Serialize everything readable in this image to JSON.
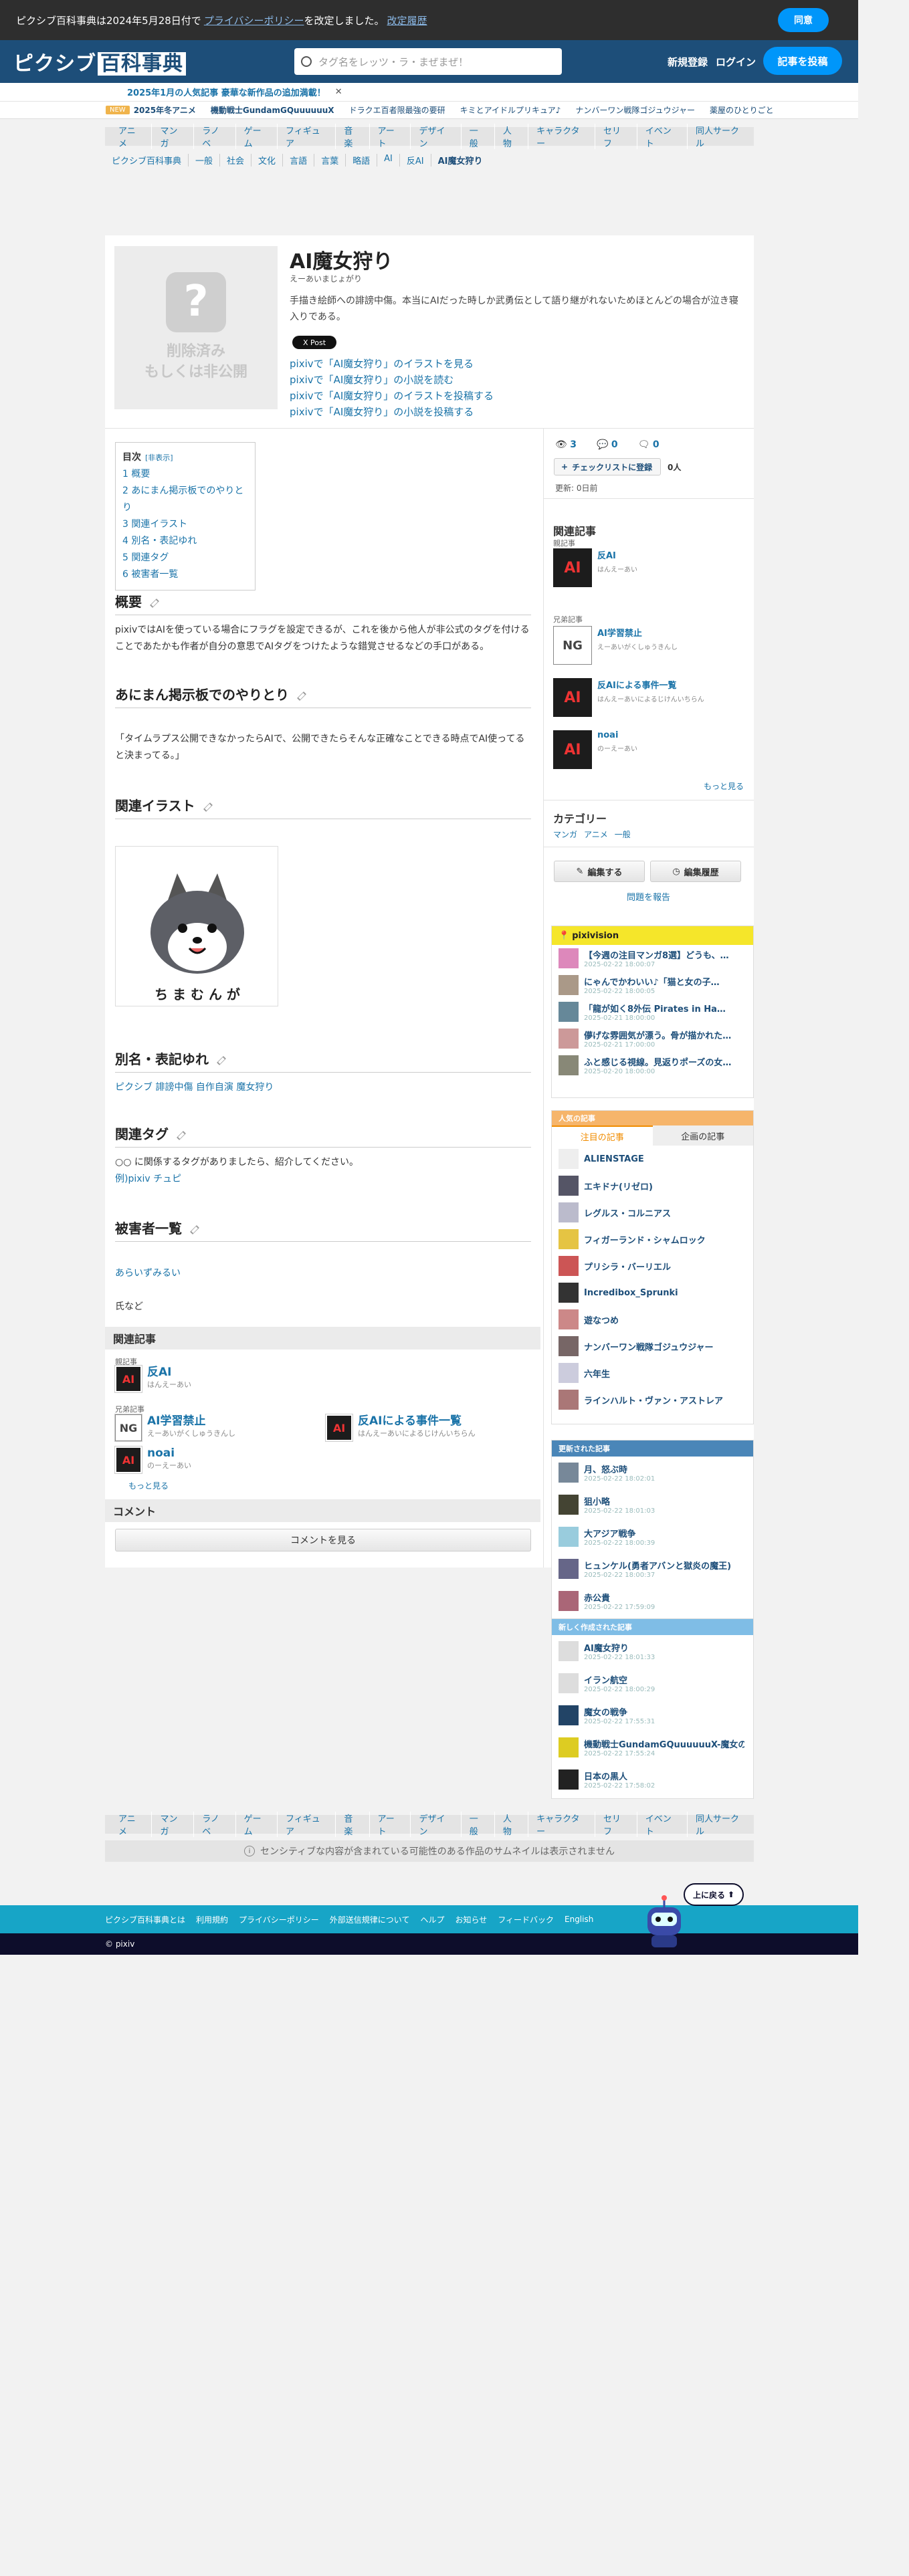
{
  "cookie": {
    "text": "ピクシブ百科事典は2024年5月28日付で",
    "link": "プライバシーポリシー",
    "text2": "を改定しました。",
    "history": "改定履歴",
    "agree": "同意"
  },
  "header": {
    "logo": "ピクシブ",
    "logo_box": "百科事典",
    "search_placeholder": "タグ名をレッツ・ラ・まぜまぜ！",
    "signup": "新規登録",
    "login": "ログイン",
    "post": "記事を投稿"
  },
  "news1": {
    "text": "2025年1月の人気記事 豪華な新作品の追加満載！",
    "close": "✕"
  },
  "news2": {
    "tag": "NEW",
    "title": "2025年冬アニメ",
    "items": [
      "機動戦士GundamGQuuuuuuX",
      "ドラクエ百者限最強の要研",
      "キミとアイドルプリキュア♪",
      "ナンバーワン戦隊ゴジュウジャー",
      "薬屋のひとりごと"
    ]
  },
  "catnav": [
    "アニメ",
    "マンガ",
    "ラノベ",
    "ゲーム",
    "フィギュア",
    "音楽",
    "アート",
    "デザイン",
    "一般",
    "人物",
    "キャラクター",
    "セリフ",
    "イベント",
    "同人サークル"
  ],
  "breadcrumbs": [
    "ピクシブ百科事典",
    "一般",
    "社会",
    "文化",
    "言語",
    "言葉",
    "略語",
    "AI",
    "反AI",
    "AI魔女狩り"
  ],
  "article": {
    "thumb_line1": "削除済み",
    "thumb_line2": "もしくは非公開",
    "title": "AI魔女狩り",
    "reading": "えーあいまじょがり",
    "summary": "手描き絵師への誹謗中傷。本当にAIだった時しか武勇伝として語り継がれないためほとんどの場合が泣き寝入りである。",
    "xpost": "X Post",
    "links": [
      "pixivで「AI魔女狩り」のイラストを見る",
      "pixivで「AI魔女狩り」の小説を読む",
      "pixivで「AI魔女狩り」のイラストを投稿する",
      "pixivで「AI魔女狩り」の小説を投稿する"
    ]
  },
  "toc": {
    "title": "目次",
    "toggle": "[非表示]",
    "items": [
      "1 概要",
      "2 あにまん掲示板でのやりとり",
      "3 関連イラスト",
      "4 別名・表記ゆれ",
      "5 関連タグ",
      "6 被害者一覧"
    ]
  },
  "sections": {
    "overview_h": "概要",
    "overview_p": "pixivではAIを使っている場合にフラグを設定できるが、これを後から他人が非公式のタグを付けることであたかも作者が自分の意思でAIタグをつけたような錯覚させるなどの手口がある。",
    "animan_h": "あにまん掲示板でのやりとり",
    "animan_p": "「タイムラプス公開できなかったらAIで、公開できたらそんな正確なことできる時点でAI使ってると決まってる。」",
    "illust_h": "関連イラスト",
    "alias_h": "別名・表記ゆれ",
    "alias_p": "ピクシブ 誹謗中傷 自作自演 魔女狩り",
    "tags_h": "関連タグ",
    "tags_p1": "○○ に関係するタグがありましたら、紹介してください。",
    "tags_p2": "例)pixiv チュピ",
    "victims_h": "被害者一覧",
    "victims_p1": "あらいずみるい",
    "victims_p2": "氏など"
  },
  "related": {
    "bar": "関連記事",
    "parent_label": "親記事",
    "parent": {
      "icon": "AI",
      "name": "反AI",
      "reading": "はんえーあい"
    },
    "sibling_label": "兄弟記事",
    "siblings": [
      {
        "icon": "NG",
        "name": "AI学習禁止",
        "reading": "えーあいがくしゅうきんし"
      },
      {
        "icon": "AI",
        "name": "反AIによる事件一覧",
        "reading": "はんえーあいによるじけんいちらん"
      },
      {
        "icon": "AI",
        "name": "noai",
        "reading": "のーえーあい"
      }
    ],
    "more": "もっと見る"
  },
  "comments": {
    "bar": "コメント",
    "button": "コメントを見る"
  },
  "side": {
    "views": "3",
    "comments": "0",
    "tags": "0",
    "checklist": "チェックリストに登録",
    "people": "0人",
    "updated": "更新: 0日前",
    "related_title": "関連記事",
    "parent_label": "親記事",
    "sibling_label": "兄弟記事",
    "more": "もっと見る",
    "category_title": "カテゴリー",
    "categories": [
      "マンガ",
      "アニメ",
      "一般"
    ],
    "edit": "編集する",
    "history": "編集履歴",
    "report": "問題を報告"
  },
  "pixivision": {
    "head": "pixivision",
    "items": [
      {
        "text": "【今週の注目マンガ8選】どうも、…",
        "date": "2025-02-22 18:00:07"
      },
      {
        "text": "にゃんでかわいい♪「猫と女の子…",
        "date": "2025-02-22 18:00:05"
      },
      {
        "text": "「龍が如く8外伝 Pirates in Ha…",
        "date": "2025-02-21 18:00:00"
      },
      {
        "text": "儚げな雰囲気が漂う。骨が描かれた…",
        "date": "2025-02-21 17:00:00"
      },
      {
        "text": "ふと感じる視線。見返りポーズの女…",
        "date": "2025-02-20 18:00:00"
      }
    ]
  },
  "popular": {
    "head": "人気の記事",
    "tab1": "注目の記事",
    "tab2": "企画の記事",
    "items": [
      "ALIENSTAGE",
      "エキドナ(リゼロ)",
      "レグルス・コルニアス",
      "フィガーランド・シャムロック",
      "プリシラ・バーリエル",
      "Incredibox_Sprunki",
      "遊なつめ",
      "ナンバーワン戦隊ゴジュウジャー",
      "六年生",
      "ラインハルト・ヴァン・アストレア"
    ]
  },
  "updated": {
    "head": "更新された記事",
    "items": [
      {
        "text": "月、怒ぶ時",
        "date": "2025-02-22 18:02:01"
      },
      {
        "text": "狙小略",
        "date": "2025-02-22 18:01:03"
      },
      {
        "text": "大アジア戦争",
        "date": "2025-02-22 18:00:39"
      },
      {
        "text": "ヒュンケル(勇者アバンと獄炎の魔王)",
        "date": "2025-02-22 18:00:37"
      },
      {
        "text": "赤公貴",
        "date": "2025-02-22 17:59:09"
      }
    ]
  },
  "new_articles": {
    "head": "新しく作成された記事",
    "items": [
      {
        "text": "AI魔女狩り",
        "date": "2025-02-22 18:01:33"
      },
      {
        "text": "イラン航空",
        "date": "2025-02-22 18:00:29"
      },
      {
        "text": "魔女の戦争",
        "date": "2025-02-22 17:55:31"
      },
      {
        "text": "機動戦士GundamGQuuuuuuX-魔女の戦争-",
        "date": "2025-02-22 17:55:24"
      },
      {
        "text": "日本の黒人",
        "date": "2025-02-22 17:58:02"
      }
    ]
  },
  "bottom": {
    "sensitive": "センシティブな内容が含まれている可能性のある作品のサムネイルは表示されません",
    "footer_links": [
      "ピクシブ百科事典とは",
      "利用規約",
      "プライバシーポリシー",
      "外部送信規律について",
      "ヘルプ",
      "お知らせ",
      "フィードバック",
      "English"
    ],
    "copyright": "© pixiv",
    "backtop": "上に戻る"
  }
}
